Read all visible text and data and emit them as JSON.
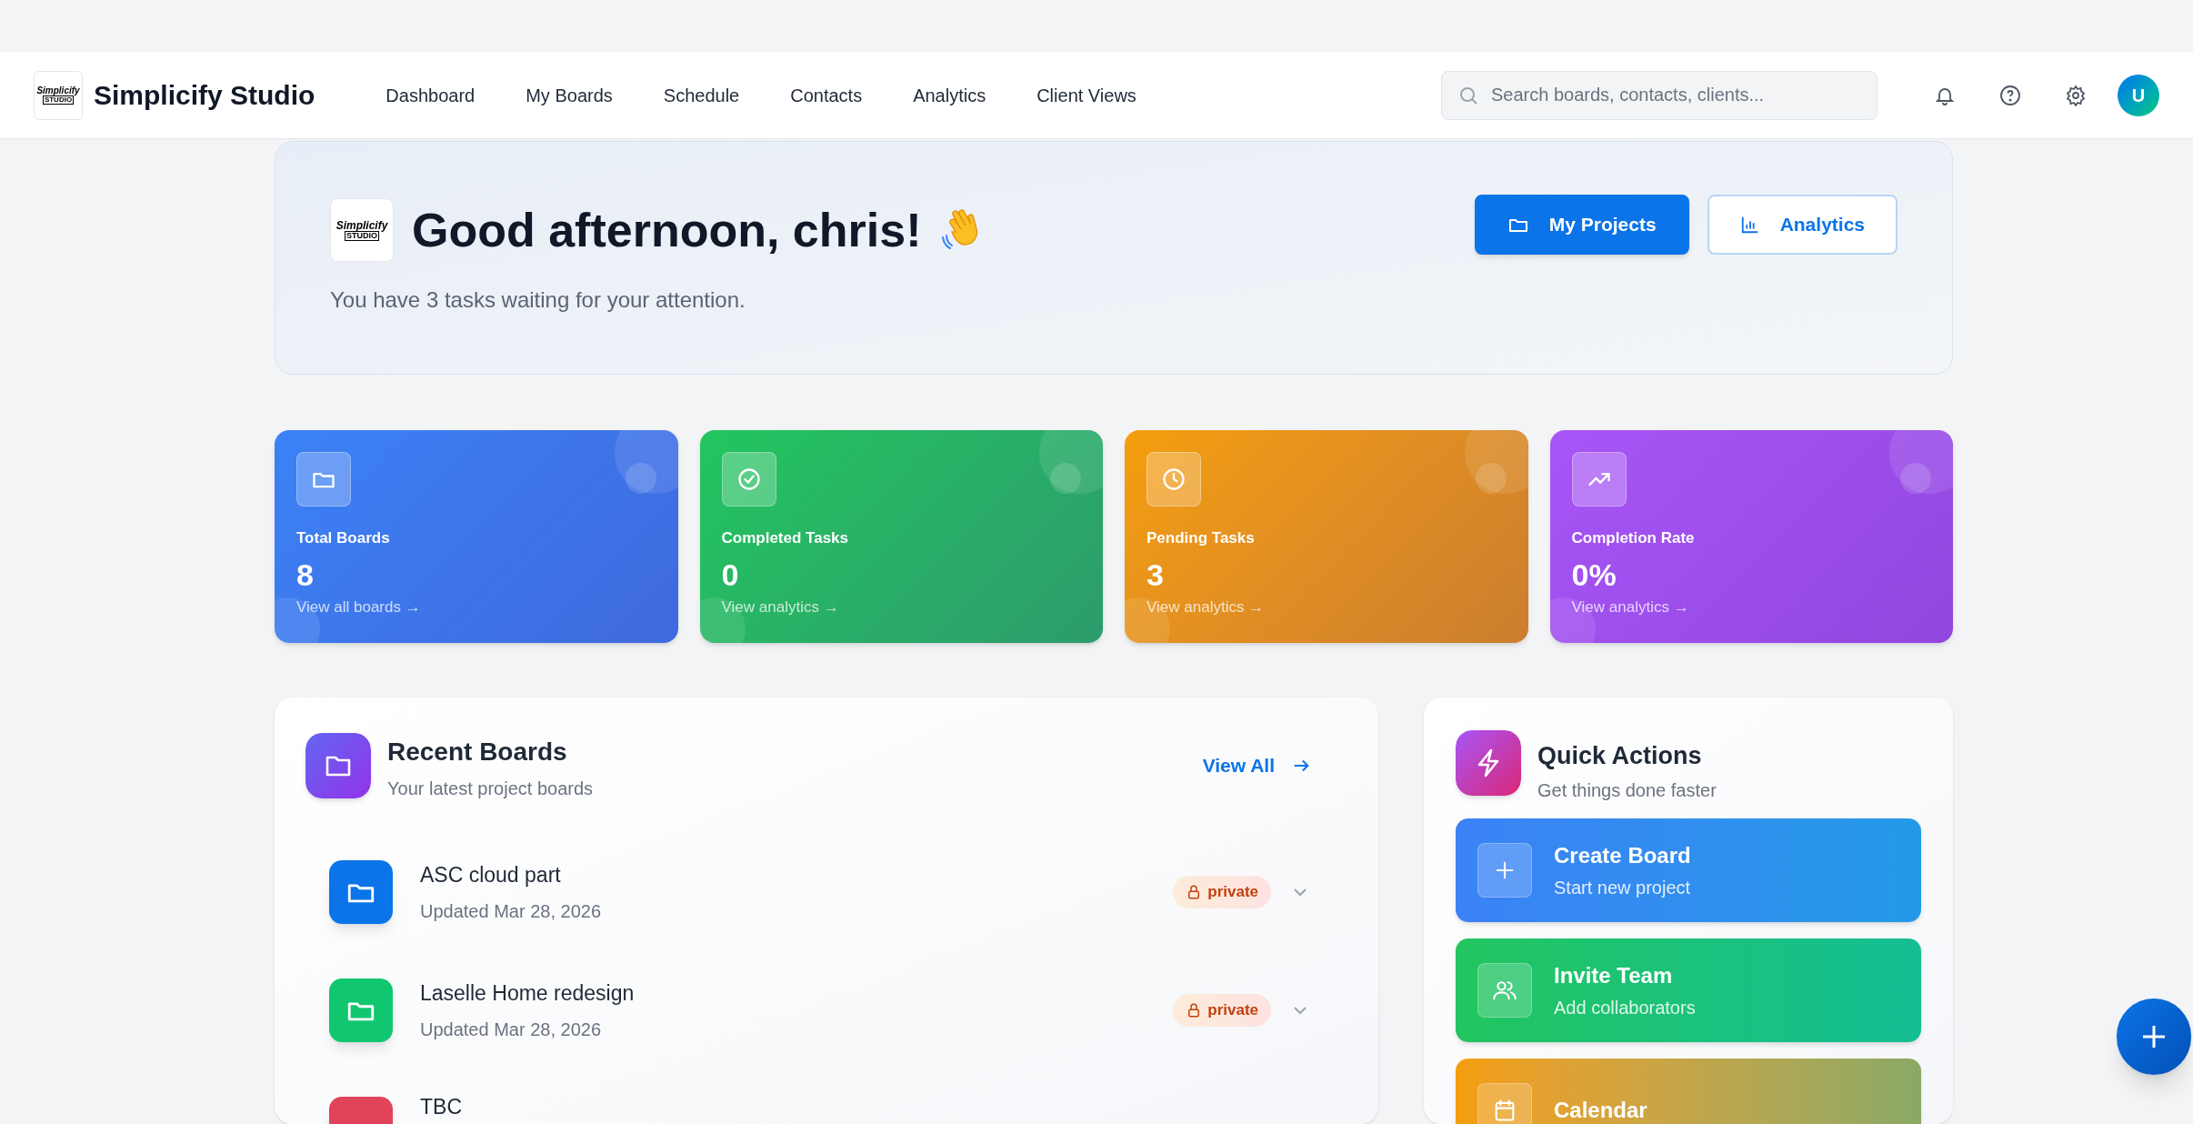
{
  "header": {
    "logo_lines": [
      "Simplicify",
      "STUDIO"
    ],
    "brand": "Simplicify Studio",
    "nav": [
      {
        "label": "Dashboard"
      },
      {
        "label": "My Boards"
      },
      {
        "label": "Schedule"
      },
      {
        "label": "Contacts"
      },
      {
        "label": "Analytics"
      },
      {
        "label": "Client Views"
      }
    ],
    "search": {
      "placeholder": "Search boards, contacts, clients..."
    },
    "avatar": "U"
  },
  "hero": {
    "logo_lines": [
      "Simplicify",
      "STUDIO"
    ],
    "title": "Good afternoon, chris!",
    "subtitle": "You have 3 tasks waiting for your attention.",
    "buttons": [
      {
        "label": "My Projects",
        "kind": "primary"
      },
      {
        "label": "Analytics",
        "kind": "outline"
      }
    ]
  },
  "stats": [
    {
      "label": "Total Boards",
      "value": "8",
      "link": "View all boards →",
      "color": "#3b82f6"
    },
    {
      "label": "Completed Tasks",
      "value": "0",
      "link": "View analytics →",
      "color": "#22c55e"
    },
    {
      "label": "Pending Tasks",
      "value": "3",
      "link": "View analytics →",
      "color": "#f59e0b"
    },
    {
      "label": "Completion Rate",
      "value": "0%",
      "link": "View analytics →",
      "color": "#a855f7"
    }
  ],
  "recent_boards": {
    "title": "Recent Boards",
    "subtitle": "Your latest project boards",
    "view_all": "View All",
    "boards": [
      {
        "name": "ASC cloud part",
        "updated": "Updated Mar 28, 2026",
        "badge": "private",
        "color": "#0b74e8"
      },
      {
        "name": "Laselle Home redesign",
        "updated": "Updated Mar 28, 2026",
        "badge": "private",
        "color": "#10c76f"
      },
      {
        "name": "TBC",
        "color": "#e0435a"
      }
    ]
  },
  "quick_actions": {
    "title": "Quick Actions",
    "subtitle": "Get things done faster",
    "actions": [
      {
        "title": "Create Board",
        "subtitle": "Start new project",
        "color": "#3b82f6"
      },
      {
        "title": "Invite Team",
        "subtitle": "Add collaborators",
        "color": "#22c55e"
      },
      {
        "title": "Calendar",
        "color": "#f59e0b"
      }
    ]
  }
}
